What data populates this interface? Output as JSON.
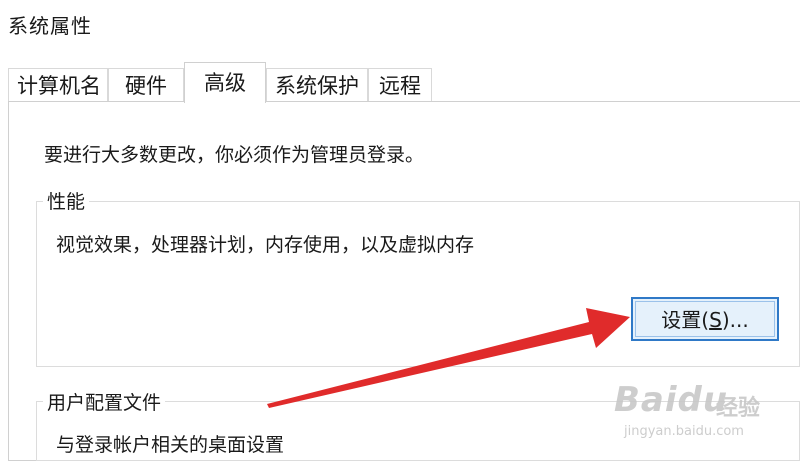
{
  "window": {
    "title": "系统属性"
  },
  "tabs": [
    {
      "label": "计算机名"
    },
    {
      "label": "硬件"
    },
    {
      "label": "高级"
    },
    {
      "label": "系统保护"
    },
    {
      "label": "远程"
    }
  ],
  "active_tab": "高级",
  "notice": "要进行大多数更改，你必须作为管理员登录。",
  "performance": {
    "label": "性能",
    "description": "视觉效果，处理器计划，内存使用，以及虚拟内存",
    "settings_button": {
      "text_before": "设置(",
      "accelerator": "S",
      "text_after": ")..."
    }
  },
  "user_profiles": {
    "label": "用户配置文件",
    "description": "与登录帐户相关的桌面设置"
  },
  "annotation": {
    "arrow_color": "#e02b2b"
  },
  "watermark": {
    "logo": "Baidu",
    "cn": "经验",
    "url": "jingyan.baidu.com"
  }
}
